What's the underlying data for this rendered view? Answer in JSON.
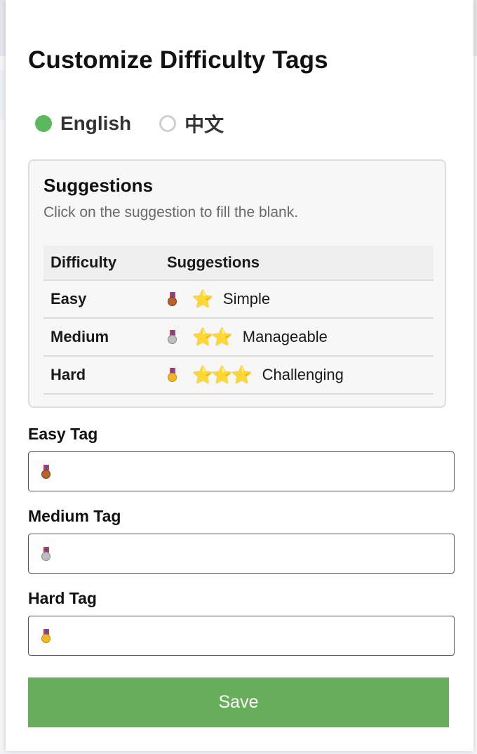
{
  "dialog": {
    "title": "Customize Difficulty Tags"
  },
  "language": {
    "selected": "English",
    "options": [
      {
        "label": "English",
        "checked": true
      },
      {
        "label": "中文",
        "checked": false
      }
    ]
  },
  "suggestions": {
    "title": "Suggestions",
    "subtitle": "Click on the suggestion to fill the blank.",
    "headers": [
      "Difficulty",
      "Suggestions"
    ],
    "rows": [
      {
        "difficulty": "Easy",
        "medal": "third-place-medal-icon",
        "stars": "⭐",
        "text": "Simple"
      },
      {
        "difficulty": "Medium",
        "medal": "second-place-medal-icon",
        "stars": "⭐⭐",
        "text": "Manageable"
      },
      {
        "difficulty": "Hard",
        "medal": "first-place-medal-icon",
        "stars": "⭐⭐⭐",
        "text": "Challenging"
      }
    ]
  },
  "fields": {
    "easy_label": "Easy Tag",
    "medium_label": "Medium Tag",
    "hard_label": "Hard Tag",
    "easy_value_icon": "third-place-medal-icon",
    "medium_value_icon": "second-place-medal-icon",
    "hard_value_icon": "first-place-medal-icon"
  },
  "save_label": "Save",
  "colors": {
    "accent": "#68ad5b",
    "radio_on": "#5cb85c"
  }
}
